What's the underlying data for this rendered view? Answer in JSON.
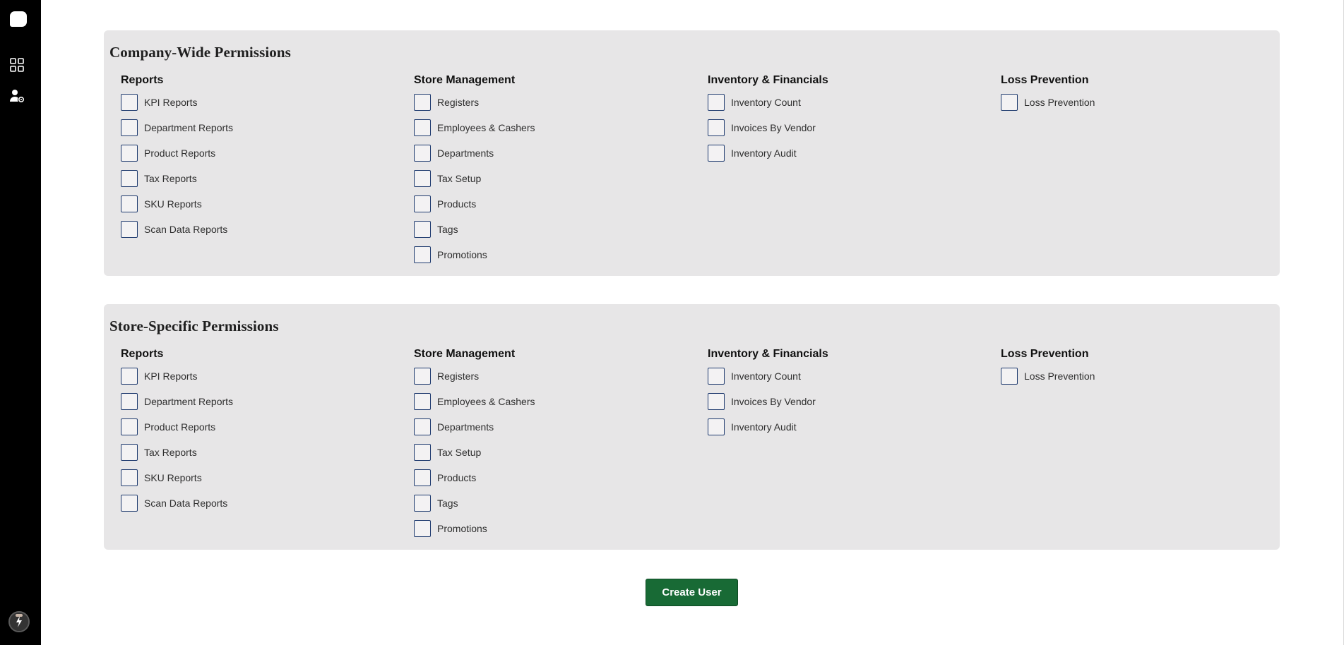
{
  "sidebar": {
    "icons": [
      "logo-icon",
      "dashboard-icon",
      "user-settings-icon",
      "avatar-icon"
    ]
  },
  "sections": [
    {
      "title": "Company-Wide Permissions",
      "columns": [
        {
          "title": "Reports",
          "options": [
            "KPI Reports",
            "Department Reports",
            "Product Reports",
            "Tax Reports",
            "SKU Reports",
            "Scan Data Reports"
          ]
        },
        {
          "title": "Store Management",
          "options": [
            "Registers",
            "Employees & Cashers",
            "Departments",
            "Tax Setup",
            "Products",
            "Tags",
            "Promotions"
          ]
        },
        {
          "title": "Inventory & Financials",
          "options": [
            "Inventory Count",
            "Invoices By Vendor",
            "Inventory Audit"
          ]
        },
        {
          "title": "Loss Prevention",
          "options": [
            "Loss Prevention"
          ]
        }
      ]
    },
    {
      "title": "Store-Specific Permissions",
      "columns": [
        {
          "title": "Reports",
          "options": [
            "KPI Reports",
            "Department Reports",
            "Product Reports",
            "Tax Reports",
            "SKU Reports",
            "Scan Data Reports"
          ]
        },
        {
          "title": "Store Management",
          "options": [
            "Registers",
            "Employees & Cashers",
            "Departments",
            "Tax Setup",
            "Products",
            "Tags",
            "Promotions"
          ]
        },
        {
          "title": "Inventory & Financials",
          "options": [
            "Inventory Count",
            "Invoices By Vendor",
            "Inventory Audit"
          ]
        },
        {
          "title": "Loss Prevention",
          "options": [
            "Loss Prevention"
          ]
        }
      ]
    }
  ],
  "actions": {
    "create_user_label": "Create User"
  },
  "colors": {
    "sidebar_bg": "#000000",
    "panel_bg": "#e7e6e7",
    "checkbox_border": "#1e3a6e",
    "primary_button": "#186a35"
  }
}
